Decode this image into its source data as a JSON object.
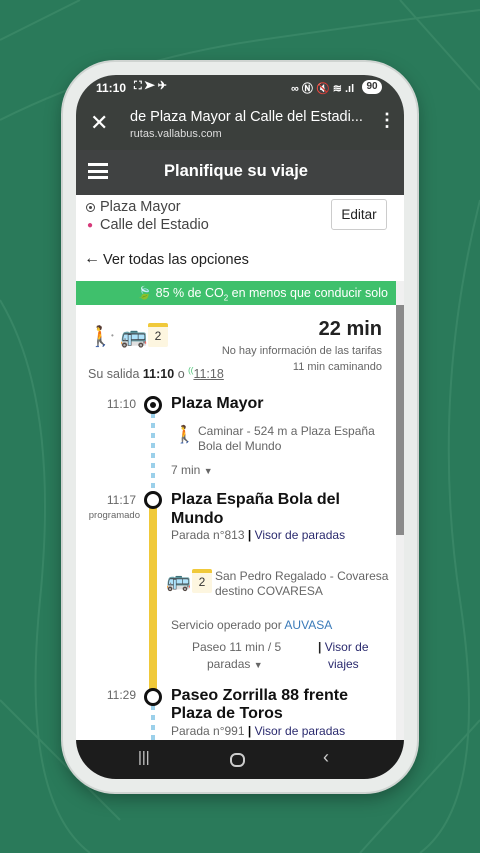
{
  "status_bar": {
    "time": "11:10",
    "battery": "90"
  },
  "browser": {
    "title": "de Plaza Mayor al Calle del Estadi...",
    "url": "rutas.vallabus.com"
  },
  "app": {
    "title": "Planifique su viaje"
  },
  "route": {
    "origin": "Plaza Mayor",
    "destination": "Calle del Estadio",
    "edit_label": "Editar",
    "back_label": "Ver todas las opciones"
  },
  "banner": {
    "text_before": "85 % de CO",
    "sub": "2",
    "text_after": " en menos que conducir solo"
  },
  "summary": {
    "line": "2",
    "duration": "22 min",
    "fare": "No hay información de las tarifas",
    "walking": "11 min caminando",
    "departure_label": "Su salida",
    "departure": "11:10",
    "or": "o",
    "alt_time": "11:18"
  },
  "legs": {
    "stop1": {
      "time": "11:10",
      "name": "Plaza Mayor"
    },
    "walk": {
      "text1": "Caminar - 524 m a Plaza España",
      "text2": "Bola del Mundo",
      "duration": "7 min"
    },
    "stop2": {
      "time": "11:17",
      "status": "programado",
      "name1": "Plaza España Bola del",
      "name2": "Mundo",
      "stop_no": "Parada n°813",
      "link": "Visor de paradas"
    },
    "bus": {
      "line": "2",
      "route": "San Pedro Regalado - Covaresa",
      "dest": "destino COVARESA",
      "operator_label": "Servicio operado por",
      "operator": "AUVASA",
      "ride1": "Paseo 11 min / 5",
      "ride2": "paradas",
      "link1": "Visor de",
      "link2": "viajes"
    },
    "stop3": {
      "time": "11:29",
      "name1": "Paseo Zorrilla 88 frente",
      "name2": "Plaza de Toros",
      "stop_no": "Parada n°991",
      "link": "Visor de paradas"
    }
  },
  "colors": {
    "banner": "#3fc06c",
    "line": "#f0c93a",
    "walk": "#9bd0ea",
    "header": "#404242"
  }
}
